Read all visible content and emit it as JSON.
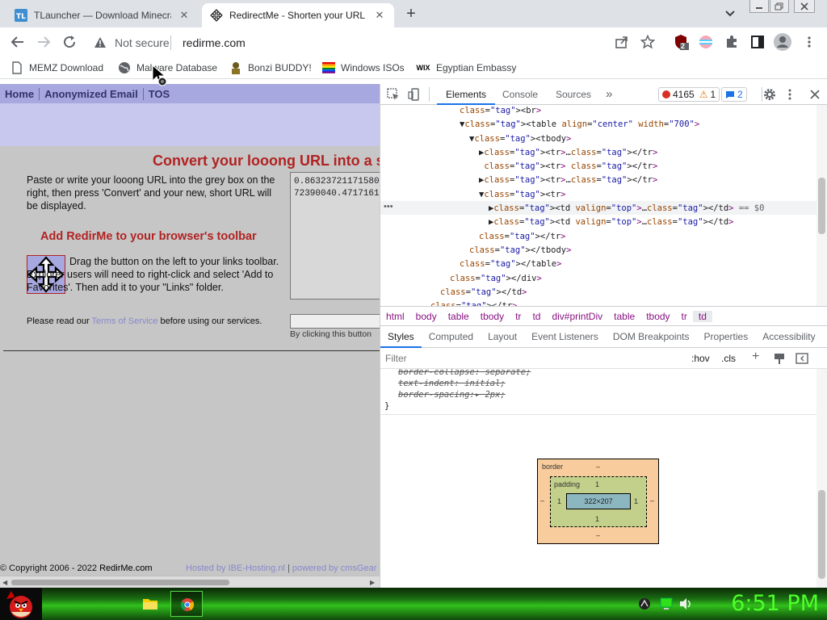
{
  "browser": {
    "tabs": [
      {
        "title": "TLauncher — Download Minecra",
        "favicon": "tlauncher-icon",
        "active": false
      },
      {
        "title": "RedirectMe - Shorten your URL t",
        "favicon": "move-icon",
        "active": true
      }
    ],
    "new_tab_label": "+",
    "address": {
      "security": "Not secure",
      "url": "redirme.com"
    },
    "extension_badge": "2",
    "bookmarks": [
      {
        "label": "MEMZ Download",
        "icon": "document-icon"
      },
      {
        "label": "Malware Database",
        "icon": "globe-icon"
      },
      {
        "label": "Bonzi BUDDY!",
        "icon": "bonzi-icon"
      },
      {
        "label": "Windows ISOs",
        "icon": "windows-flag-icon"
      },
      {
        "label": "Egyptian Embassy",
        "icon": "wix-icon"
      }
    ],
    "wix_text": "WIX"
  },
  "site": {
    "nav": [
      "Home",
      "Anonymized Email",
      "TOS"
    ],
    "heading": "Convert your looong URL into a s",
    "instructions": "Paste or write your looong URL into the grey box on the right, then press 'Convert' and your new, short URL will be displayed.",
    "toolbar_heading": "Add RedirMe to your browser's toolbar",
    "toolbar_text": "Drag the button on the left to your links toolbar. Explorer users will need to right-click and select 'Add to Favorites'. Then add it to your \"Links\" folder.",
    "read_prefix": "Please read our ",
    "terms_link": "Terms of Service",
    "read_suffix": " before using our services.",
    "url_box_lines": [
      "0.86323721171580",
      "72390040.4717161"
    ],
    "click_note": "By clicking this button",
    "copyright_prefix": "© Copyright 2006 - 2022 ",
    "copyright_site": "RedirMe.com",
    "hosted_by": "Hosted by IBE-Hosting.nl",
    "powered_sep": "|",
    "powered_by": "powered by cmsGear"
  },
  "devtools": {
    "tabs": [
      "Elements",
      "Console",
      "Sources"
    ],
    "more": "»",
    "errors": "4165",
    "warnings": "1",
    "messages": "2",
    "dom_lines": [
      {
        "indent": 0,
        "text": "<br>"
      },
      {
        "indent": 0,
        "text": "▼<table align=\"center\" width=\"700\">"
      },
      {
        "indent": 1,
        "text": "▼<tbody>"
      },
      {
        "indent": 2,
        "text": "▶<tr>…</tr>"
      },
      {
        "indent": 2,
        "text": " <tr> </tr>"
      },
      {
        "indent": 2,
        "text": "▶<tr>…</tr>"
      },
      {
        "indent": 2,
        "text": "▼<tr>"
      },
      {
        "indent": 3,
        "text": "▶<td valign=\"top\">…</td> == $0"
      },
      {
        "indent": 3,
        "text": "▶<td valign=\"top\">…</td>"
      },
      {
        "indent": 2,
        "text": "</tr>"
      },
      {
        "indent": 1,
        "text": "</tbody>"
      },
      {
        "indent": 0,
        "text": "</table>"
      },
      {
        "indent": -1,
        "text": "</div>"
      },
      {
        "indent": -2,
        "text": "</td>"
      },
      {
        "indent": -3,
        "text": "</tr>"
      }
    ],
    "breadcrumbs": [
      "html",
      "body",
      "table",
      "tbody",
      "tr",
      "td",
      "div#printDiv",
      "table",
      "tbody",
      "tr",
      "td"
    ],
    "style_tabs": [
      "Styles",
      "Computed",
      "Layout",
      "Event Listeners",
      "DOM Breakpoints",
      "Properties",
      "Accessibility"
    ],
    "filter_placeholder": "Filter",
    "hov": ":hov",
    "cls": ".cls",
    "css_lines": [
      "border-collapse: separate;",
      "text-indent: initial;",
      "border-spacing:▸ 2px;"
    ],
    "css_close": "}",
    "boxmodel": {
      "border_label": "border",
      "border_val": "–",
      "padding_label": "padding",
      "padding_val": "1",
      "content": "322×207",
      "margin_side": "–",
      "padding_side": "1"
    }
  },
  "taskbar": {
    "clock": "6:51 PM"
  }
}
